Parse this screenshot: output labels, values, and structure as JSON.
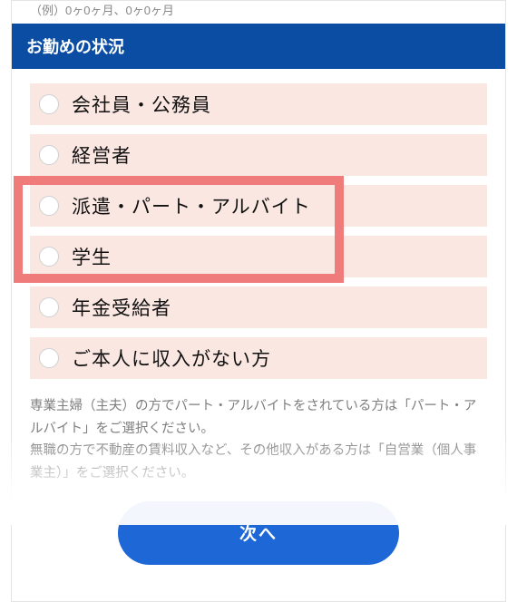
{
  "prev_hint": "（例）0ヶ0ヶ月、0ヶ0ヶ月",
  "section": {
    "title": "お勤めの状況"
  },
  "options": [
    {
      "label": "会社員・公務員"
    },
    {
      "label": "経営者"
    },
    {
      "label": "派遣・パート・アルバイト"
    },
    {
      "label": "学生"
    },
    {
      "label": "年金受給者"
    },
    {
      "label": "ご本人に収入がない方"
    }
  ],
  "help": {
    "line1": "専業主婦（主夫）の方でパート・アルバイトをされている方は「パート・アルバイト」をご選択ください。",
    "line2": "無職の方で不動産の賃料収入など、その他収入がある方は「自営業（個人事業主）」をご選択ください。"
  },
  "buttons": {
    "next": "次へ"
  }
}
